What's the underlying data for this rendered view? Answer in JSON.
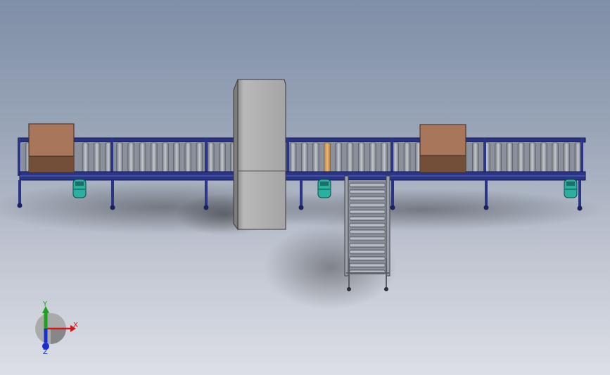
{
  "viewport": {
    "background_top": "#7f8fa7",
    "background_bottom": "#dcdfe6"
  },
  "model": {
    "frame_color": "#2b3585",
    "roller_color": "#9aa0aa",
    "box_color": "#a8765a",
    "scanner_color": "#a9a9a9",
    "motor_color": "#2bb0a0",
    "highlight_roller_color": "#d6a05a"
  },
  "triad": {
    "x_label": "X",
    "y_label": "Y",
    "z_label": "Z",
    "x_color": "#d01818",
    "y_color": "#20a020",
    "z_color": "#1a2fd0"
  }
}
